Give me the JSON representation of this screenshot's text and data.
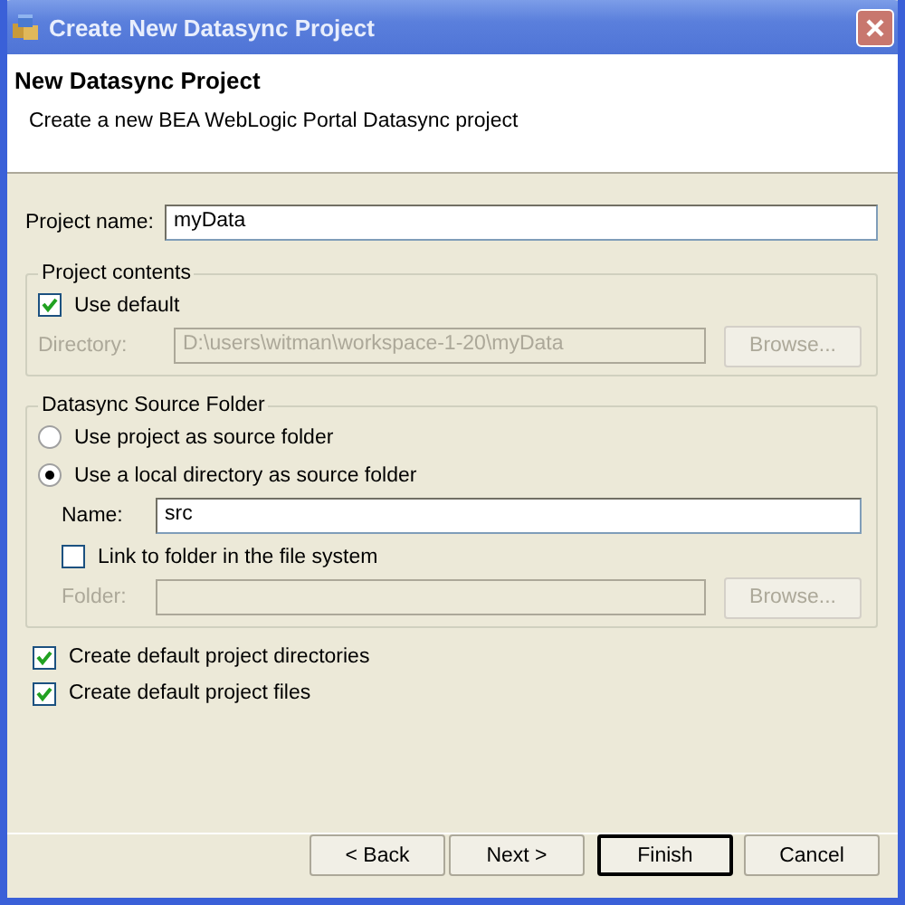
{
  "window": {
    "title": "Create New Datasync Project"
  },
  "header": {
    "title": "New Datasync Project",
    "description": "Create a new BEA WebLogic Portal Datasync project"
  },
  "project_name": {
    "label": "Project name:",
    "value": "myData"
  },
  "project_contents": {
    "legend": "Project contents",
    "use_default": {
      "label": "Use default",
      "checked": true
    },
    "directory": {
      "label": "Directory:",
      "value": "D:\\users\\witman\\workspace-1-20\\myData",
      "disabled": true
    },
    "browse": {
      "label": "Browse...",
      "disabled": true
    }
  },
  "source_folder": {
    "legend": "Datasync Source Folder",
    "options": [
      {
        "label": "Use project as source folder",
        "selected": false
      },
      {
        "label": "Use a local directory as source folder",
        "selected": true
      }
    ],
    "name": {
      "label": "Name:",
      "value": "src"
    },
    "link": {
      "label": "Link to folder in the file system",
      "checked": false
    },
    "folder": {
      "label": "Folder:",
      "disabled": true
    },
    "browse": {
      "label": "Browse...",
      "disabled": true
    }
  },
  "options": [
    {
      "label": "Create default project directories",
      "checked": true
    },
    {
      "label": "Create default project files",
      "checked": true
    }
  ],
  "buttons": [
    {
      "label": "< Back",
      "default": false
    },
    {
      "label": "Next >",
      "default": false
    },
    {
      "label": "Finish",
      "default": true
    },
    {
      "label": "Cancel",
      "default": false
    }
  ]
}
